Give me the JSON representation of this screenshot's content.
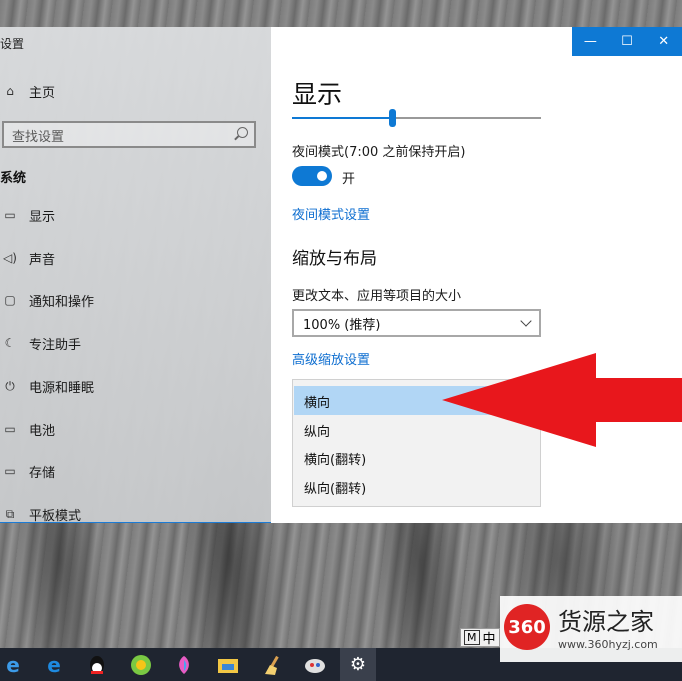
{
  "window": {
    "app_title": "设置",
    "controls": {
      "minimize": "—",
      "maximize": "☐",
      "close": "✕"
    }
  },
  "sidebar": {
    "home": "主页",
    "search_placeholder": "查找设置",
    "section": "系统",
    "items": [
      {
        "label": "显示",
        "icon": "monitor-icon",
        "glyph": "▭"
      },
      {
        "label": "声音",
        "icon": "speaker-icon",
        "glyph": "🔈"
      },
      {
        "label": "通知和操作",
        "icon": "notification-icon",
        "glyph": "▢"
      },
      {
        "label": "专注助手",
        "icon": "moon-icon",
        "glyph": "☾"
      },
      {
        "label": "电源和睡眠",
        "icon": "power-icon",
        "glyph": "⏻"
      },
      {
        "label": "电池",
        "icon": "battery-icon",
        "glyph": "▭"
      },
      {
        "label": "存储",
        "icon": "storage-icon",
        "glyph": "▭"
      },
      {
        "label": "平板模式",
        "icon": "tablet-mode-icon",
        "glyph": "⧉"
      }
    ]
  },
  "content": {
    "heading": "显示",
    "brightness_level": 0.4,
    "night_mode_label": "夜间模式(7:00 之前保持开启)",
    "night_mode_state": "开",
    "night_mode_link": "夜间模式设置",
    "scale_heading": "缩放与布局",
    "scale_label": "更改文本、应用等项目的大小",
    "scale_value": "100% (推荐)",
    "advanced_link": "高级缩放设置",
    "orientation_options": [
      "横向",
      "纵向",
      "横向(翻转)",
      "纵向(翻转)"
    ],
    "orientation_selected": "横向"
  },
  "taskbar": {
    "ime_mode": "M",
    "ime_lang": "中",
    "icons": [
      "edge-icon",
      "ie-icon",
      "qq-icon",
      "browser-icon",
      "paint3d-icon",
      "file-explorer-icon",
      "cleaner-icon",
      "game-icon",
      "settings-icon"
    ]
  },
  "watermark": {
    "logo": "360",
    "name": "货源之家",
    "url": "www.360hyzj.com"
  },
  "colors": {
    "accent": "#0e79d4",
    "arrow": "#e8171c"
  }
}
